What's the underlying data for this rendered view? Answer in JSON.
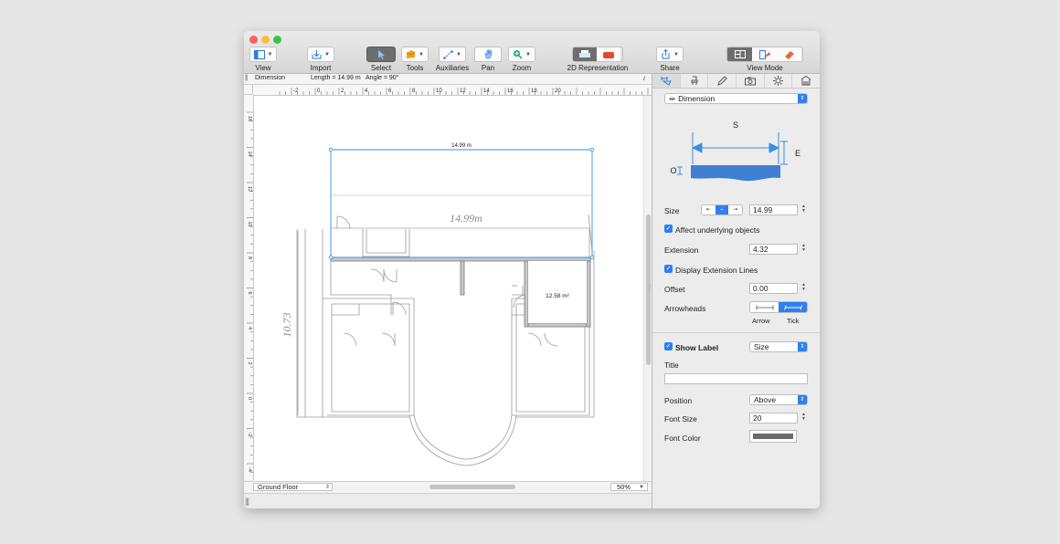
{
  "toolbar": {
    "items": [
      {
        "id": "view",
        "label": "View"
      },
      {
        "id": "import",
        "label": "Import"
      },
      {
        "id": "select",
        "label": "Select"
      },
      {
        "id": "tools",
        "label": "Tools"
      },
      {
        "id": "auxiliaries",
        "label": "Auxiliaries"
      },
      {
        "id": "pan",
        "label": "Pan"
      },
      {
        "id": "zoom",
        "label": "Zoom"
      },
      {
        "id": "representation",
        "label": "2D Representation"
      },
      {
        "id": "share",
        "label": "Share"
      },
      {
        "id": "viewmode",
        "label": "View Mode"
      }
    ]
  },
  "infobar": {
    "tool": "Dimension",
    "length": "Length = 14.99 m",
    "angle": "Angle = 90°",
    "info_icon": "i"
  },
  "ruler": {
    "h_labels": [
      "-2",
      "0",
      "2",
      "4",
      "6",
      "8",
      "10",
      "12",
      "14",
      "16",
      "18",
      "20"
    ],
    "v_labels": [
      "16",
      "14",
      "12",
      "10",
      "8",
      "6",
      "4",
      "2",
      "0",
      "-2",
      "-4"
    ]
  },
  "plan": {
    "dimension_label": "14.99 m",
    "sketch_top": "14.99m",
    "sketch_side": "10.73",
    "room_area": "12.58 m²"
  },
  "bottom": {
    "floor": "Ground Floor",
    "zoom": "50%"
  },
  "inspector": {
    "tabs": [
      "dimension-tab",
      "furniture-tab",
      "pencil-tab",
      "camera-tab",
      "light-tab",
      "building-tab"
    ],
    "type_popup": "Dimension",
    "diagram": {
      "s": "S",
      "e": "E",
      "o": "O"
    },
    "size_label": "Size",
    "size_value": "14.99",
    "affect_label": "Affect underlying objects",
    "extension_label": "Extension",
    "extension_value": "4.32",
    "display_ext_label": "Display Extension Lines",
    "offset_label": "Offset",
    "offset_value": "0.00",
    "arrowheads_label": "Arrowheads",
    "arrow_label": "Arrow",
    "tick_label": "Tick",
    "show_label": "Show Label",
    "label_popup": "Size",
    "title_label": "Title",
    "title_value": "",
    "position_label": "Position",
    "position_value": "Above",
    "font_size_label": "Font Size",
    "font_size_value": "20",
    "font_color_label": "Font Color",
    "font_color": "#6a6a6a"
  },
  "colors": {
    "accent": "#2f7ff0",
    "dimension_line": "#3a8ee6",
    "wall": "#888888",
    "close": "#fc605c",
    "minimize": "#fdbc40",
    "maximize": "#34c84a"
  }
}
